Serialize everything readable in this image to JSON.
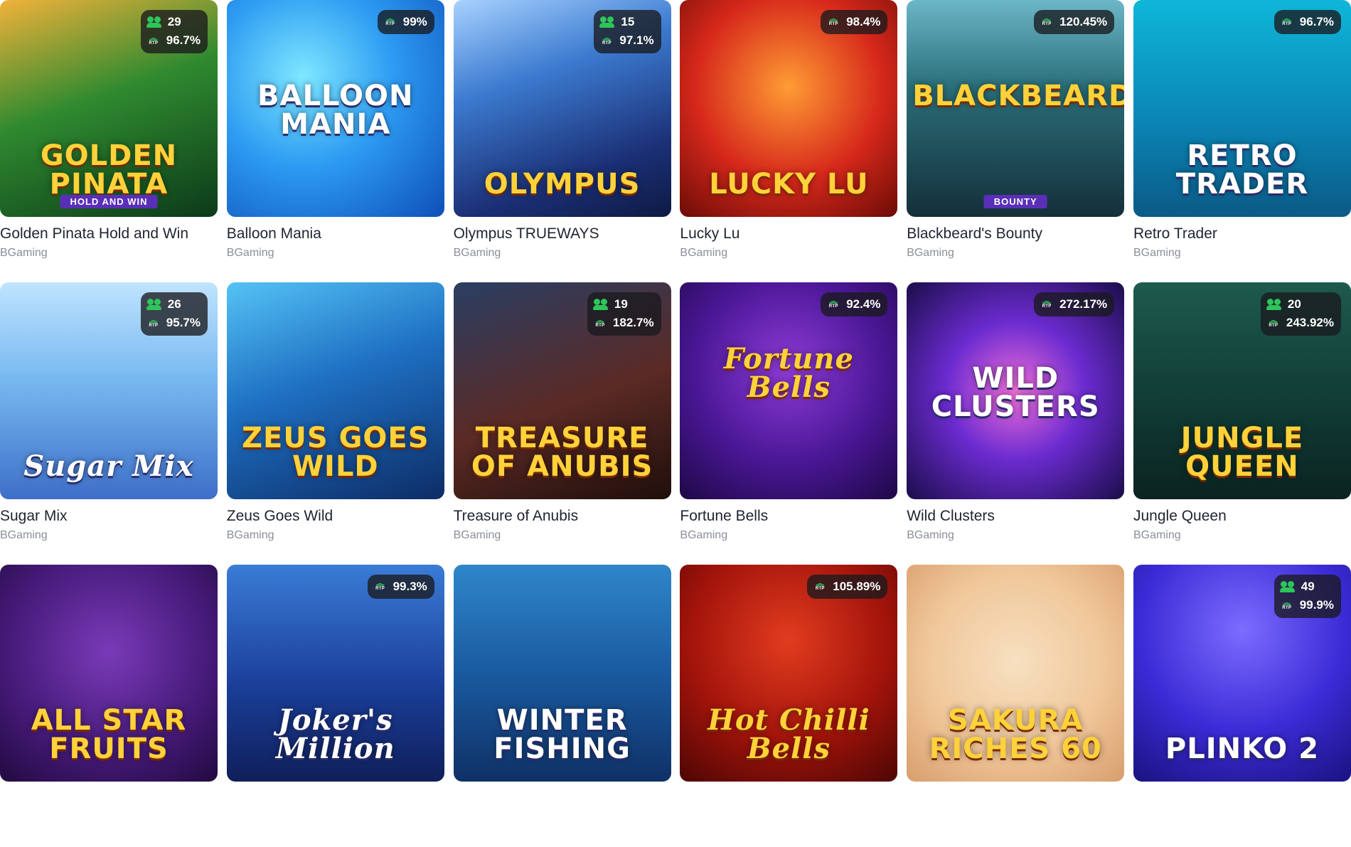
{
  "games": [
    {
      "title": "Golden Pinata Hold and Win",
      "provider": "BGaming",
      "logo": "Golden Pinata",
      "sublogo": "HOLD AND WIN",
      "players": "29",
      "rtp": "96.7%",
      "bg": "linear-gradient(160deg,#f1b23a 0%,#2f8a2f 45%,#0c3a1a 100%)",
      "logo_style": ""
    },
    {
      "title": "Balloon Mania",
      "provider": "BGaming",
      "logo": "Balloon Mania",
      "sublogo": "",
      "players": "",
      "rtp": "99%",
      "bg": "radial-gradient(circle at 35% 35%,#7ee7ff 0%,#2d9cf2 45%,#0e4fb8 100%)",
      "logo_style": "style-white mid"
    },
    {
      "title": "Olympus TRUEWAYS",
      "provider": "BGaming",
      "logo": "Olympus",
      "sublogo": "",
      "players": "15",
      "rtp": "97.1%",
      "bg": "linear-gradient(160deg,#a8d2ff 0%,#3c7bd0 35%,#1b2f75 75%,#0e1a44 100%)",
      "logo_style": ""
    },
    {
      "title": "Lucky Lu",
      "provider": "BGaming",
      "logo": "Lucky Lu",
      "sublogo": "",
      "players": "",
      "rtp": "98.4%",
      "bg": "radial-gradient(circle at 50% 40%,#ff9c34 0%,#d6281b 55%,#6b0c06 100%)",
      "logo_style": ""
    },
    {
      "title": "Blackbeard's Bounty",
      "provider": "BGaming",
      "logo": "Blackbeard's",
      "sublogo": "BOUNTY",
      "players": "",
      "rtp": "120.45%",
      "bg": "linear-gradient(180deg,#6bb6c8 0%,#2a6f7a 40%,#142f3a 100%)",
      "logo_style": "mid"
    },
    {
      "title": "Retro Trader",
      "provider": "BGaming",
      "logo": "Retro Trader",
      "sublogo": "",
      "players": "",
      "rtp": "96.7%",
      "bg": "linear-gradient(180deg,#0fb6d9 0%,#0a86b6 55%,#0b5a86 100%)",
      "logo_style": "style-white"
    },
    {
      "title": "Sugar Mix",
      "provider": "BGaming",
      "logo": "Sugar Mix",
      "sublogo": "",
      "players": "26",
      "rtp": "95.7%",
      "bg": "linear-gradient(180deg,#bfe4ff 0%,#77b8f0 45%,#3d6fc8 100%)",
      "logo_style": "style-white style-script"
    },
    {
      "title": "Zeus Goes Wild",
      "provider": "BGaming",
      "logo": "Zeus Goes Wild",
      "sublogo": "",
      "players": "",
      "rtp": "",
      "bg": "linear-gradient(160deg,#54c3f5 0%,#1e6fc2 45%,#0d2d66 100%)",
      "logo_style": ""
    },
    {
      "title": "Treasure of Anubis",
      "provider": "BGaming",
      "logo": "Treasure of Anubis",
      "sublogo": "",
      "players": "19",
      "rtp": "182.7%",
      "bg": "linear-gradient(160deg,#2a3e63 0%,#5b2a25 55%,#1f0e0b 100%)",
      "logo_style": ""
    },
    {
      "title": "Fortune Bells",
      "provider": "BGaming",
      "logo": "Fortune Bells",
      "sublogo": "",
      "players": "",
      "rtp": "92.4%",
      "bg": "radial-gradient(circle at 50% 40%,#8e3bd6 0%,#4a1796 55%,#1e0846 100%)",
      "logo_style": "style-script top"
    },
    {
      "title": "Wild Clusters",
      "provider": "BGaming",
      "logo": "Wild Clusters",
      "sublogo": "",
      "players": "",
      "rtp": "272.17%",
      "bg": "radial-gradient(circle at 50% 50%,#f06ed8 0%,#6b2bd0 45%,#1b0d4a 100%)",
      "logo_style": "style-white mid"
    },
    {
      "title": "Jungle Queen",
      "provider": "BGaming",
      "logo": "Jungle Queen",
      "sublogo": "",
      "players": "20",
      "rtp": "243.92%",
      "bg": "linear-gradient(180deg,#1e5a4e 0%,#123f38 50%,#0a2320 100%)",
      "logo_style": ""
    },
    {
      "title": "",
      "provider": "",
      "logo": "All Star Fruits",
      "sublogo": "",
      "players": "",
      "rtp": "",
      "bg": "radial-gradient(circle at 50% 40%,#7a3ab8 0%,#451a78 60%,#220a40 100%)",
      "logo_style": ""
    },
    {
      "title": "",
      "provider": "",
      "logo": "Joker's Million",
      "sublogo": "",
      "players": "",
      "rtp": "99.3%",
      "bg": "linear-gradient(180deg,#3a7cd6 0%,#1b3f9a 55%,#0f1f5a 100%)",
      "logo_style": "style-white style-script"
    },
    {
      "title": "",
      "provider": "",
      "logo": "Winter Fishing",
      "sublogo": "",
      "players": "",
      "rtp": "",
      "bg": "linear-gradient(180deg,#2f86c9 0%,#1a5aa0 50%,#0f3166 100%)",
      "logo_style": "style-white"
    },
    {
      "title": "",
      "provider": "",
      "logo": "Hot Chilli Bells",
      "sublogo": "",
      "players": "",
      "rtp": "105.89%",
      "bg": "radial-gradient(circle at 50% 35%,#e23c1f 0%,#a3140b 55%,#4d0604 100%)",
      "logo_style": "style-script"
    },
    {
      "title": "",
      "provider": "",
      "logo": "Sakura Riches 60",
      "sublogo": "",
      "players": "",
      "rtp": "",
      "bg": "radial-gradient(circle at 50% 45%,#f7e0c0 0%,#f0c79a 55%,#d89d6c 100%)",
      "logo_style": ""
    },
    {
      "title": "",
      "provider": "",
      "logo": "Plinko 2",
      "sublogo": "",
      "players": "49",
      "rtp": "99.9%",
      "bg": "radial-gradient(circle at 50% 30%,#7d6cff 0%,#3b2bd6 55%,#1a1280 100%)",
      "logo_style": "style-white"
    }
  ],
  "rtp_icon_label": "RTP"
}
